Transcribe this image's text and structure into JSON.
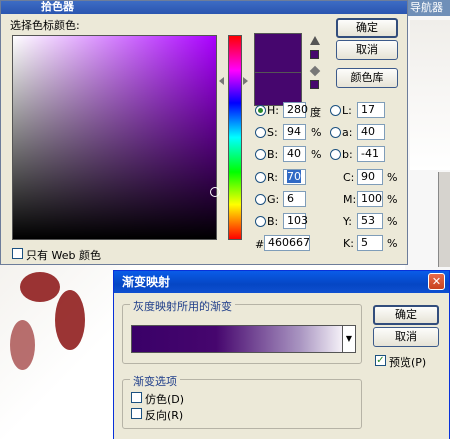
{
  "background": {
    "navigator_title": "导航器"
  },
  "color_picker": {
    "title": "拾色器",
    "select_label": "选择色标颜色:",
    "ok": "确定",
    "cancel": "取消",
    "color_libraries": "颜色库",
    "web_only": "只有 Web 颜色",
    "fields": {
      "H": {
        "label": "H:",
        "value": "280",
        "unit": "度"
      },
      "S": {
        "label": "S:",
        "value": "94",
        "unit": "%"
      },
      "B": {
        "label": "B:",
        "value": "40",
        "unit": "%"
      },
      "R": {
        "label": "R:",
        "value": "70"
      },
      "G": {
        "label": "G:",
        "value": "6"
      },
      "Bl": {
        "label": "B:",
        "value": "103"
      },
      "L": {
        "label": "L:",
        "value": "17"
      },
      "a": {
        "label": "a:",
        "value": "40"
      },
      "b": {
        "label": "b:",
        "value": "-41"
      },
      "C": {
        "label": "C:",
        "value": "90",
        "unit": "%"
      },
      "M": {
        "label": "M:",
        "value": "100",
        "unit": "%"
      },
      "Y": {
        "label": "Y:",
        "value": "53",
        "unit": "%"
      },
      "K": {
        "label": "K:",
        "value": "5",
        "unit": "%"
      }
    },
    "hash": "#",
    "hex": "460667",
    "current_color": "#46066e"
  },
  "gradient_map": {
    "title": "渐变映射",
    "group_label": "灰度映射所用的渐变",
    "ok": "确定",
    "cancel": "取消",
    "preview": "预览(P)",
    "options_label": "渐变选项",
    "dither": "仿色(D)",
    "reverse": "反向(R)"
  }
}
